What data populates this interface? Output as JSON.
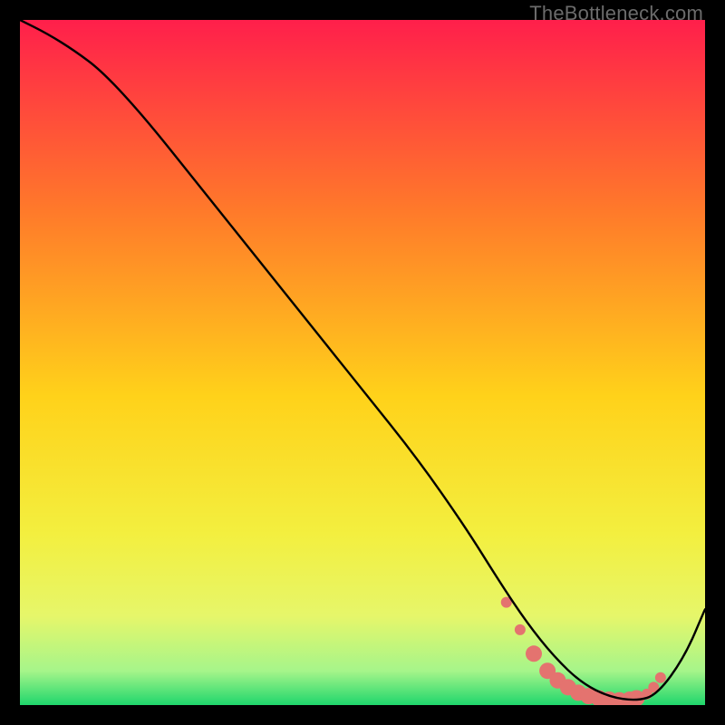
{
  "watermark": "TheBottleneck.com",
  "colors": {
    "gradient_top": "#ff1f4b",
    "gradient_25": "#ff7a2a",
    "gradient_50": "#ffd21a",
    "gradient_70": "#f3ef3f",
    "gradient_82": "#e6f66a",
    "gradient_92": "#a6f58a",
    "gradient_bottom": "#1fd66c",
    "curve": "#000000",
    "dots": "#e4736f"
  },
  "chart_data": {
    "type": "line",
    "title": "",
    "xlabel": "",
    "ylabel": "",
    "xlim": [
      0,
      100
    ],
    "ylim": [
      0,
      100
    ],
    "series": [
      {
        "name": "bottleneck-curve",
        "x": [
          0,
          4,
          8,
          12,
          18,
          26,
          34,
          42,
          50,
          58,
          65,
          70,
          74,
          78,
          82,
          86,
          90,
          93,
          97,
          100
        ],
        "y": [
          100,
          98,
          95.5,
          92.5,
          86,
          76,
          66,
          56,
          46,
          36,
          26,
          18,
          12,
          7,
          3.2,
          1.2,
          0.6,
          1.5,
          7,
          14
        ]
      }
    ],
    "dots": {
      "name": "highlight-region-dots",
      "x": [
        71,
        73,
        75,
        77,
        78.5,
        80,
        81.5,
        83,
        84.5,
        86,
        87.5,
        89,
        90,
        91.5,
        92.5,
        93.5
      ],
      "y": [
        15,
        11,
        7.5,
        5,
        3.6,
        2.6,
        1.8,
        1.3,
        1.0,
        0.8,
        0.7,
        0.8,
        1.0,
        1.6,
        2.6,
        4
      ],
      "radius": [
        6,
        6,
        9,
        9,
        9,
        9,
        9,
        9,
        9,
        9,
        9,
        9,
        9,
        6,
        6,
        6
      ]
    }
  }
}
